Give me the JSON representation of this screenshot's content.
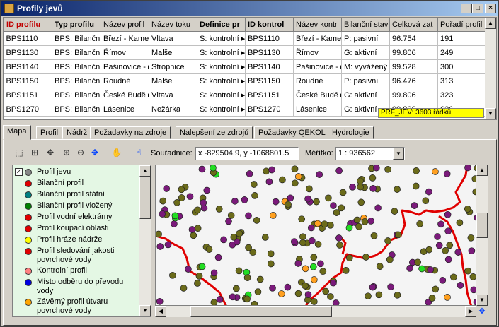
{
  "window": {
    "title": "Profily jevů",
    "min": "_",
    "max": "□",
    "close": "×"
  },
  "grid": {
    "columns": [
      "ID profilu",
      "Typ profilu",
      "Název profil",
      "Název toku",
      "Definice pr",
      "ID kontrol",
      "Název kontr",
      "Bilanční stav",
      "Celková zat",
      "Pořadí profil"
    ],
    "rows": [
      [
        "BPS1110",
        "BPS: Bilančn ▸",
        "Březí - Kame ▸",
        "Vltava",
        "S: kontrolní ▸",
        "BPS1110",
        "Březí - Kame ▸",
        "P: pasivní",
        "96.754",
        "191"
      ],
      [
        "BPS1130",
        "BPS: Bilančn ▸",
        "Římov",
        "Malše",
        "S: kontrolní ▸",
        "BPS1130",
        "Římov",
        "G: aktivní",
        "99.806",
        "249"
      ],
      [
        "BPS1140",
        "BPS: Bilančn ▸",
        "Pašinovice - ▸",
        "Stropnice",
        "S: kontrolní ▸",
        "BPS1140",
        "Pašinovice - ▸",
        "M: vyvážený",
        "99.528",
        "300"
      ],
      [
        "BPS1150",
        "BPS: Bilančn ▸",
        "Roudné",
        "Malše",
        "S: kontrolní ▸",
        "BPS1150",
        "Roudné",
        "P: pasivní",
        "96.476",
        "313"
      ],
      [
        "BPS1151",
        "BPS: Bilančn ▸",
        "České Budě ▸",
        "Vltava",
        "S: kontrolní ▸",
        "BPS1151",
        "České Budě ▸",
        "G: aktivní",
        "99.806",
        "323"
      ],
      [
        "BPS1270",
        "BPS: Bilančn ▸",
        "Lásenice",
        "Nežárka",
        "S: kontrolní ▸",
        "BPS1270",
        "Lásenice",
        "G: aktivní",
        "99.806",
        "626"
      ]
    ],
    "row_count": "PRF_JEV: 3603 řádků"
  },
  "tabs": [
    "Mapa",
    "Profil",
    "Nádrž",
    "Požadavky na zdroje",
    "Nalepšení ze zdrojů",
    "Požadavky QEKOL",
    "Hydrologie"
  ],
  "toolbar": {
    "coord_label": "Souřadnice:",
    "coord_value": "x -829504.9, y -1068801.5",
    "scale_label": "Měřítko:",
    "scale_value": "1 : 936562"
  },
  "legend": {
    "checkbox": "✓",
    "items": [
      {
        "label": "Profil jevu",
        "color": "#888888"
      },
      {
        "label": "Bilanční profil",
        "color": "#e00000"
      },
      {
        "label": "Bilanční profil státní",
        "color": "#008080"
      },
      {
        "label": "Bilanční profil vložený",
        "color": "#008000"
      },
      {
        "label": "Profil vodní elektrárny",
        "color": "#e00000"
      },
      {
        "label": "Profil koupací oblasti",
        "color": "#e00000"
      },
      {
        "label": "Profil hráze nádrže",
        "color": "#ffff00"
      },
      {
        "label": "Profil sledování jakosti povrchové vody",
        "color": "#e00000"
      },
      {
        "label": "Kontrolní profil",
        "color": "#ff8080"
      },
      {
        "label": "Místo odběru do převodu vody",
        "color": "#0000e0"
      },
      {
        "label": "Závěrný profil útvaru povrchové vody",
        "color": "#ffa500"
      }
    ]
  },
  "colors": {
    "point_olive": "#6b6b1a",
    "point_purple": "#7a1a7a",
    "point_green": "#22dd22",
    "point_orange": "#ffa020",
    "river_red": "#e00000"
  }
}
